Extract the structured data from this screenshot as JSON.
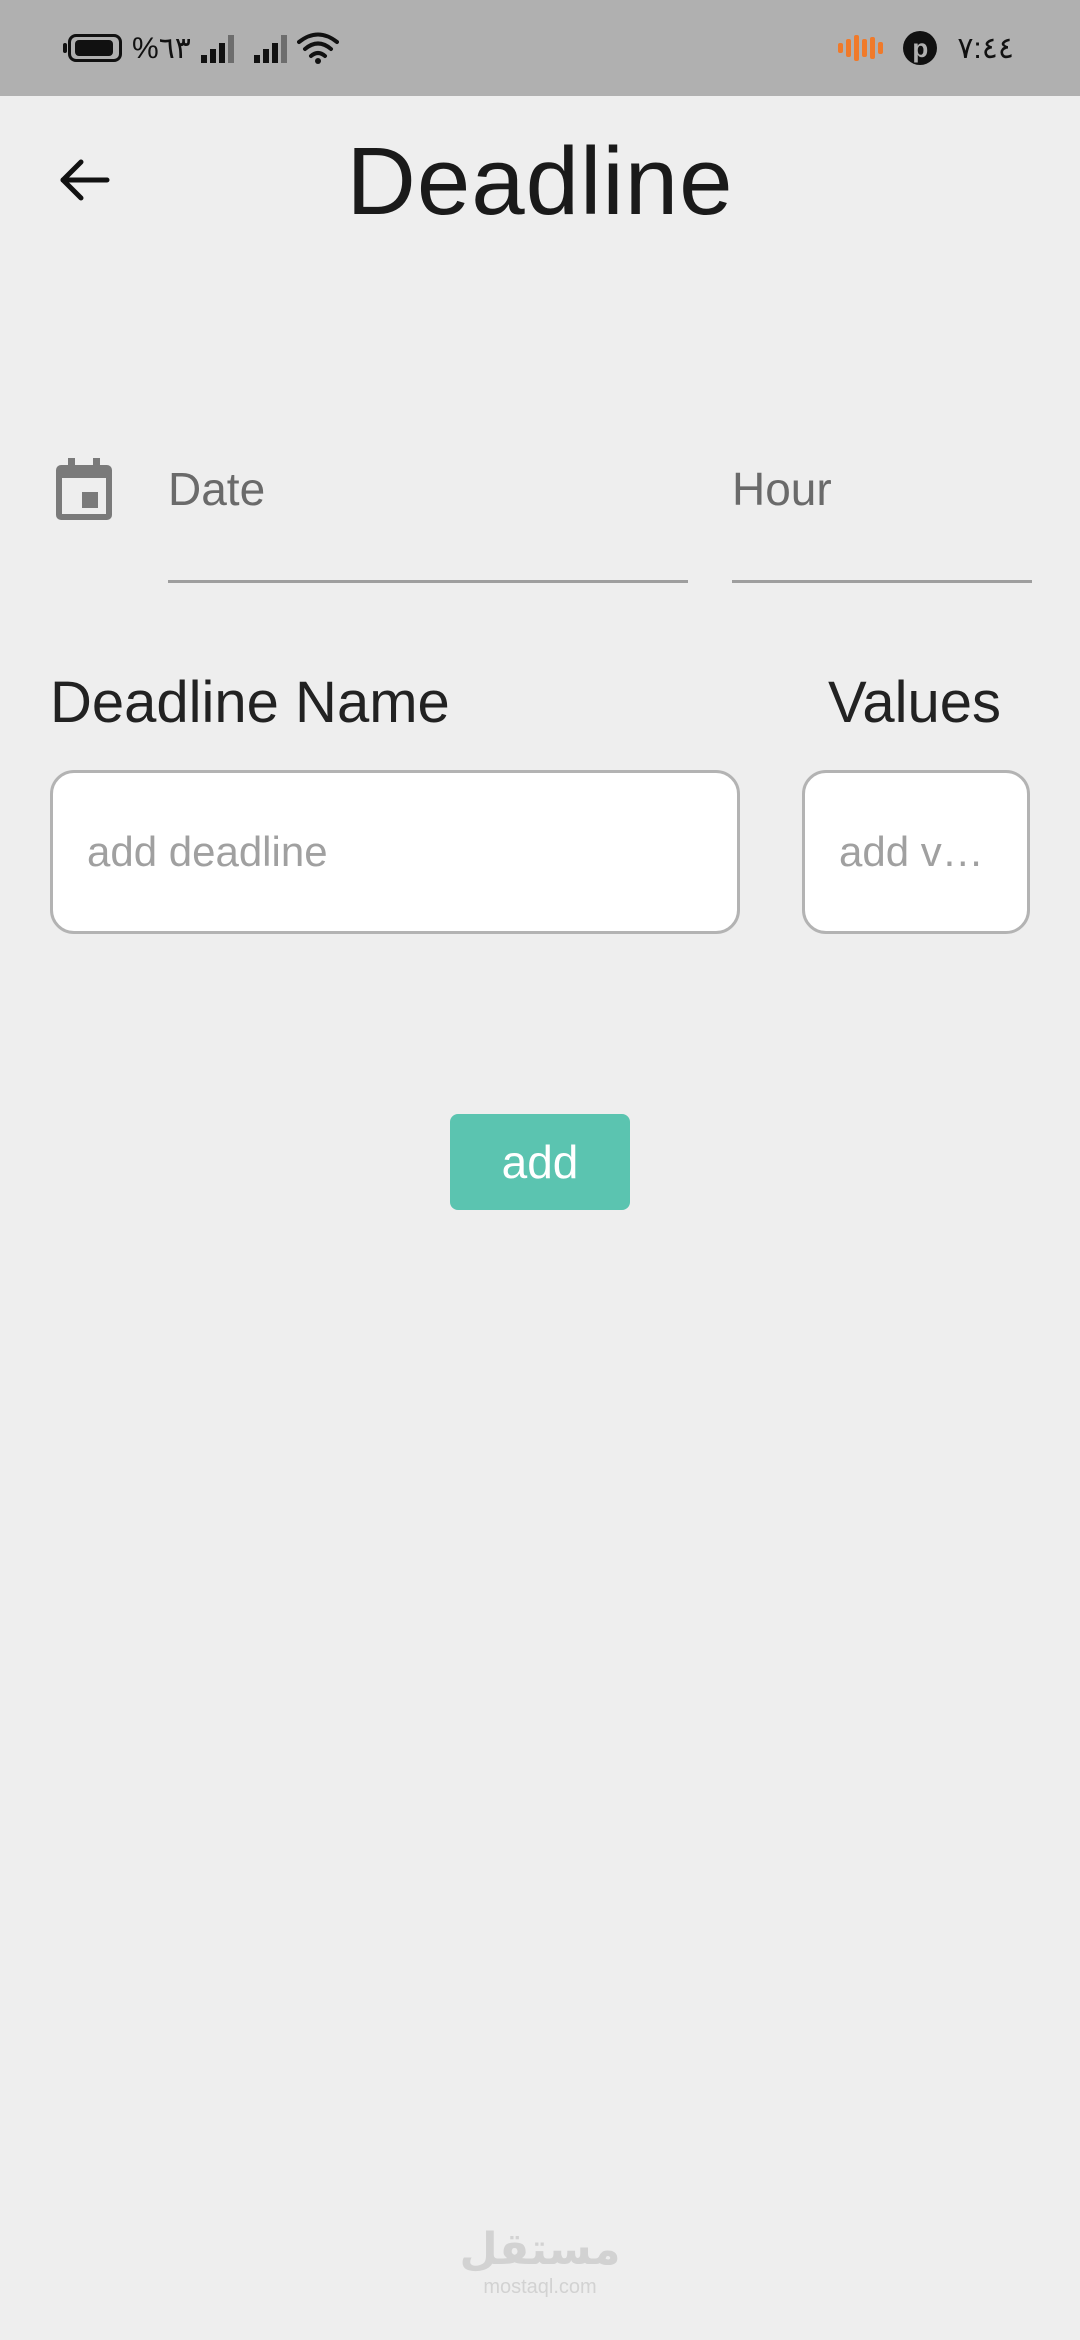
{
  "status_bar": {
    "battery_text": "%٦٣",
    "time": "٧:٤٤",
    "audio_color": "#f07a2a"
  },
  "app_bar": {
    "title": "Deadline",
    "back_icon": "arrow-left-icon"
  },
  "form": {
    "date_label": "Date",
    "hour_label": "Hour",
    "calendar_icon": "calendar-icon",
    "deadline_name_label": "Deadline Name",
    "values_label": "Values",
    "deadline_input": {
      "value": "",
      "placeholder": "add deadline"
    },
    "values_input": {
      "value": "",
      "placeholder": "add value"
    },
    "add_button_label": "add",
    "accent_color": "#5bc4b0"
  },
  "watermark": {
    "main": "مستقل",
    "sub": "mostaql.com"
  }
}
